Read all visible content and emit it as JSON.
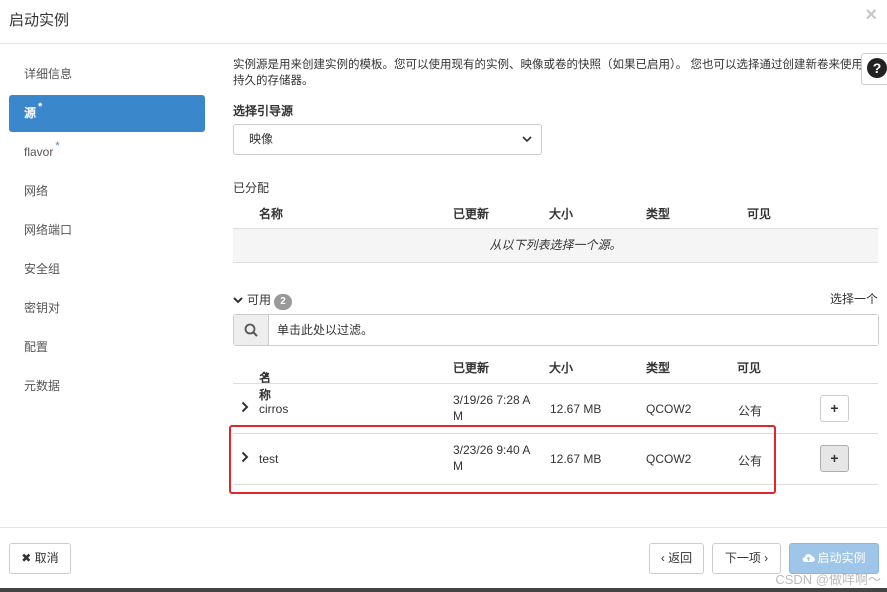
{
  "header": {
    "title": "启动实例",
    "close": "×"
  },
  "sidebar": {
    "items": [
      {
        "label": "详细信息",
        "required": ""
      },
      {
        "label": "源",
        "required": "*"
      },
      {
        "label": "flavor",
        "required": "*"
      },
      {
        "label": "网络",
        "required": ""
      },
      {
        "label": "网络端口",
        "required": ""
      },
      {
        "label": "安全组",
        "required": ""
      },
      {
        "label": "密钥对",
        "required": ""
      },
      {
        "label": "配置",
        "required": ""
      },
      {
        "label": "元数据",
        "required": ""
      }
    ],
    "active_index": 1
  },
  "content": {
    "description": "实例源是用来创建实例的模板。您可以使用现有的实例、映像或卷的快照（如果已启用）。 您也可以选择通过创建新卷来使用持久的存储器。",
    "help": "?",
    "boot_source_label": "选择引导源",
    "boot_source_value": "映像",
    "allocated_label": "已分配",
    "allocated_columns": [
      "名称",
      "已更新",
      "大小",
      "类型",
      "可见"
    ],
    "allocated_empty": "从以下列表选择一个源。",
    "available_label": "可用",
    "available_count": "2",
    "select_one": "选择一个",
    "filter_placeholder": "单击此处以过滤。",
    "available_columns": [
      "名称",
      "已更新",
      "大小",
      "类型",
      "可见"
    ],
    "sort_indicator": "▲",
    "rows": [
      {
        "name": "cirros",
        "updated_1": "3/19/26 7:28 A",
        "updated_2": "M",
        "size": "12.67 MB",
        "type": "QCOW2",
        "visibility": "公有",
        "add": "+"
      },
      {
        "name": "test",
        "updated_1": "3/23/26 9:40 A",
        "updated_2": "M",
        "size": "12.67 MB",
        "type": "QCOW2",
        "visibility": "公有",
        "add": "+"
      }
    ]
  },
  "footer": {
    "cancel": "✖ 取消",
    "back": "‹ 返回",
    "next": "下一项 ›",
    "launch": "启动实例",
    "watermark": "CSDN @做咩啊～"
  },
  "colors": {
    "accent": "#3a87cc",
    "highlight": "#e0262a",
    "primary_disabled": "#9fc5e8"
  }
}
